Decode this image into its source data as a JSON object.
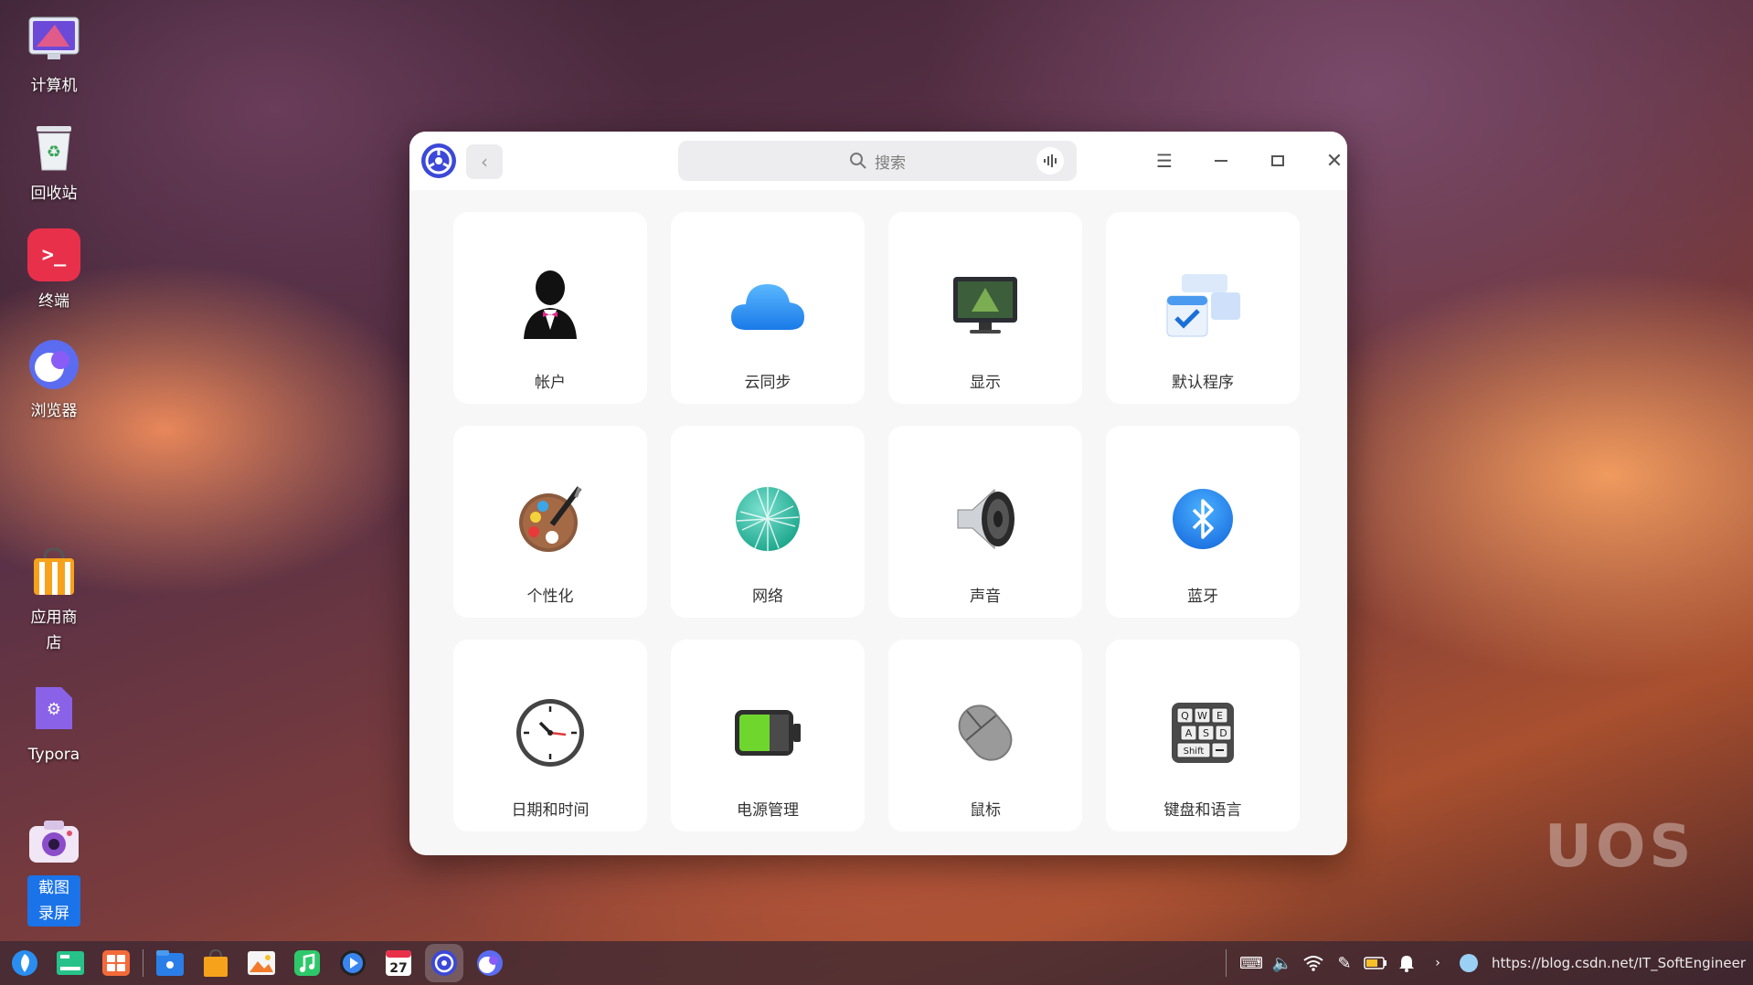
{
  "desktop": {
    "items": [
      {
        "label": "计算机",
        "icon": "computer-icon"
      },
      {
        "label": "回收站",
        "icon": "trash-icon"
      },
      {
        "label": "终端",
        "icon": "terminal-icon"
      },
      {
        "label": "浏览器",
        "icon": "browser-icon"
      },
      {
        "label": "应用商店",
        "icon": "app-store-icon"
      },
      {
        "label": "Typora",
        "icon": "typora-icon"
      },
      {
        "label": "截图录屏",
        "icon": "screenshot-icon"
      }
    ]
  },
  "window": {
    "search": {
      "placeholder": "搜索"
    },
    "modules": [
      {
        "label": "帐户",
        "icon": "account-icon"
      },
      {
        "label": "云同步",
        "icon": "cloud-sync-icon"
      },
      {
        "label": "显示",
        "icon": "display-icon"
      },
      {
        "label": "默认程序",
        "icon": "default-apps-icon"
      },
      {
        "label": "个性化",
        "icon": "personalization-icon"
      },
      {
        "label": "网络",
        "icon": "network-icon"
      },
      {
        "label": "声音",
        "icon": "sound-icon"
      },
      {
        "label": "蓝牙",
        "icon": "bluetooth-icon"
      },
      {
        "label": "日期和时间",
        "icon": "datetime-icon"
      },
      {
        "label": "电源管理",
        "icon": "power-icon"
      },
      {
        "label": "鼠标",
        "icon": "mouse-icon"
      },
      {
        "label": "键盘和语言",
        "icon": "keyboard-icon"
      }
    ]
  },
  "watermark": "UOS",
  "taskbar": {
    "url": "https://blog.csdn.net/IT_SoftEngineer"
  },
  "colors": {
    "accent": "#1a73e8",
    "window_bg": "#f7f7f8",
    "tile_bg": "#ffffff"
  }
}
